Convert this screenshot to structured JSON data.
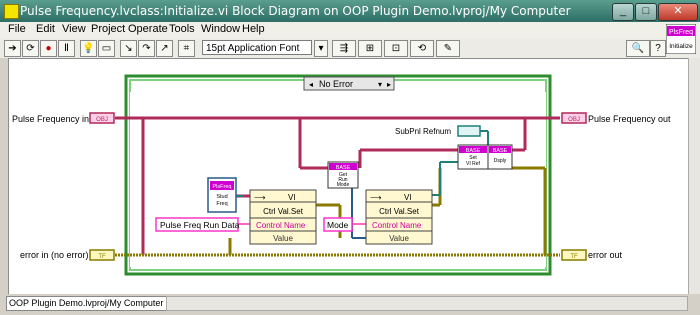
{
  "window": {
    "title": "Pulse Frequency.lvclass:Initialize.vi Block Diagram on OOP Plugin Demo.lvproj/My Computer",
    "min": "_",
    "max": "□",
    "close": "✕"
  },
  "menu": [
    "File",
    "Edit",
    "View",
    "Project",
    "Operate",
    "Tools",
    "Window",
    "Help"
  ],
  "toolbar": {
    "font": "15pt Application Font",
    "icons": [
      "run-arrow-icon",
      "run-continuous-icon",
      "abort-icon",
      "pause-icon",
      "highlight-execution-icon",
      "retain-wire-values-icon",
      "step-into-icon",
      "step-over-icon",
      "step-out-icon",
      "align-icon",
      "distribute-icon",
      "resize-icon",
      "reorder-icon",
      "cleanup-icon",
      "search-icon",
      "help-icon"
    ]
  },
  "vi_icon": {
    "line1": "PlsFreq",
    "line2": "Initialize"
  },
  "diagram": {
    "case_selector": "No Error",
    "terminals": {
      "pulse_in": "Pulse Frequency in",
      "pulse_in_tag": "OBJ",
      "pulse_out": "Pulse Frequency out",
      "pulse_out_tag": "OBJ",
      "error_in": "error in (no error)",
      "error_in_tag": "TF",
      "error_out": "error out",
      "error_out_tag": "TF"
    },
    "subpnl_label": "SubPnl Refnum",
    "class_const": {
      "line1": "PlsFreq",
      "line2": "Stud",
      "line3": "Freq"
    },
    "node1": {
      "header": "VI",
      "title": "Ctrl Val.Set",
      "row1": "Control Name",
      "row2": "Value"
    },
    "node2": {
      "header": "VI",
      "title": "Ctrl Val.Set",
      "row1": "Control Name",
      "row2": "Value"
    },
    "const1": "Pulse Freq Run Data",
    "const2": "Mode",
    "base1": {
      "tag": "BASE",
      "l1": "Get",
      "l2": "Run",
      "l3": "Mode"
    },
    "base2": {
      "tag": "BASE",
      "l1": "Set",
      "l2": "VI Ref"
    },
    "base3": {
      "tag": "BASE",
      "l1": "Dsply"
    }
  },
  "status": {
    "path": "OOP Plugin Demo.lvproj/My Computer"
  }
}
